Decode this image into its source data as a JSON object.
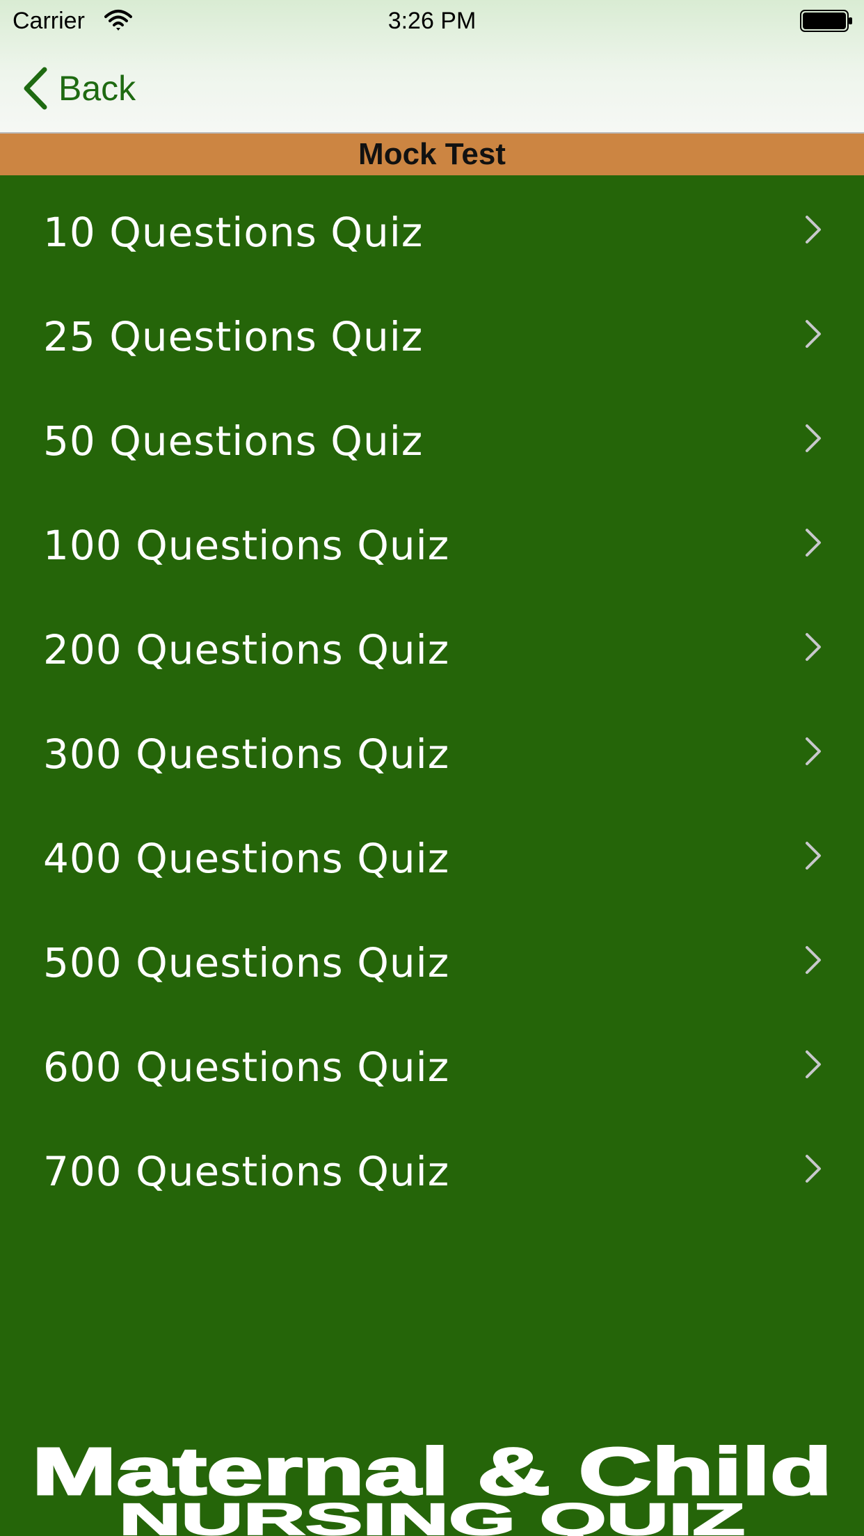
{
  "status_bar": {
    "carrier": "Carrier",
    "time": "3:26 PM",
    "wifi_icon": "wifi-icon",
    "battery_icon": "battery-icon"
  },
  "nav": {
    "back_label": "Back",
    "back_icon": "chevron-left-icon",
    "accent_color": "#1e6a11"
  },
  "section": {
    "title": "Mock Test",
    "color": "#cc8542"
  },
  "list": {
    "background": "#256509",
    "items": [
      {
        "label": "10 Questions Quiz"
      },
      {
        "label": "25 Questions Quiz"
      },
      {
        "label": "50 Questions Quiz"
      },
      {
        "label": "100 Questions Quiz"
      },
      {
        "label": "200 Questions Quiz"
      },
      {
        "label": "300 Questions Quiz"
      },
      {
        "label": "400 Questions Quiz"
      },
      {
        "label": "500 Questions Quiz"
      },
      {
        "label": "600 Questions Quiz"
      },
      {
        "label": "700 Questions Quiz"
      }
    ]
  },
  "logo": {
    "line1": "Maternal & Child",
    "line2": "NURSING QUIZ"
  }
}
